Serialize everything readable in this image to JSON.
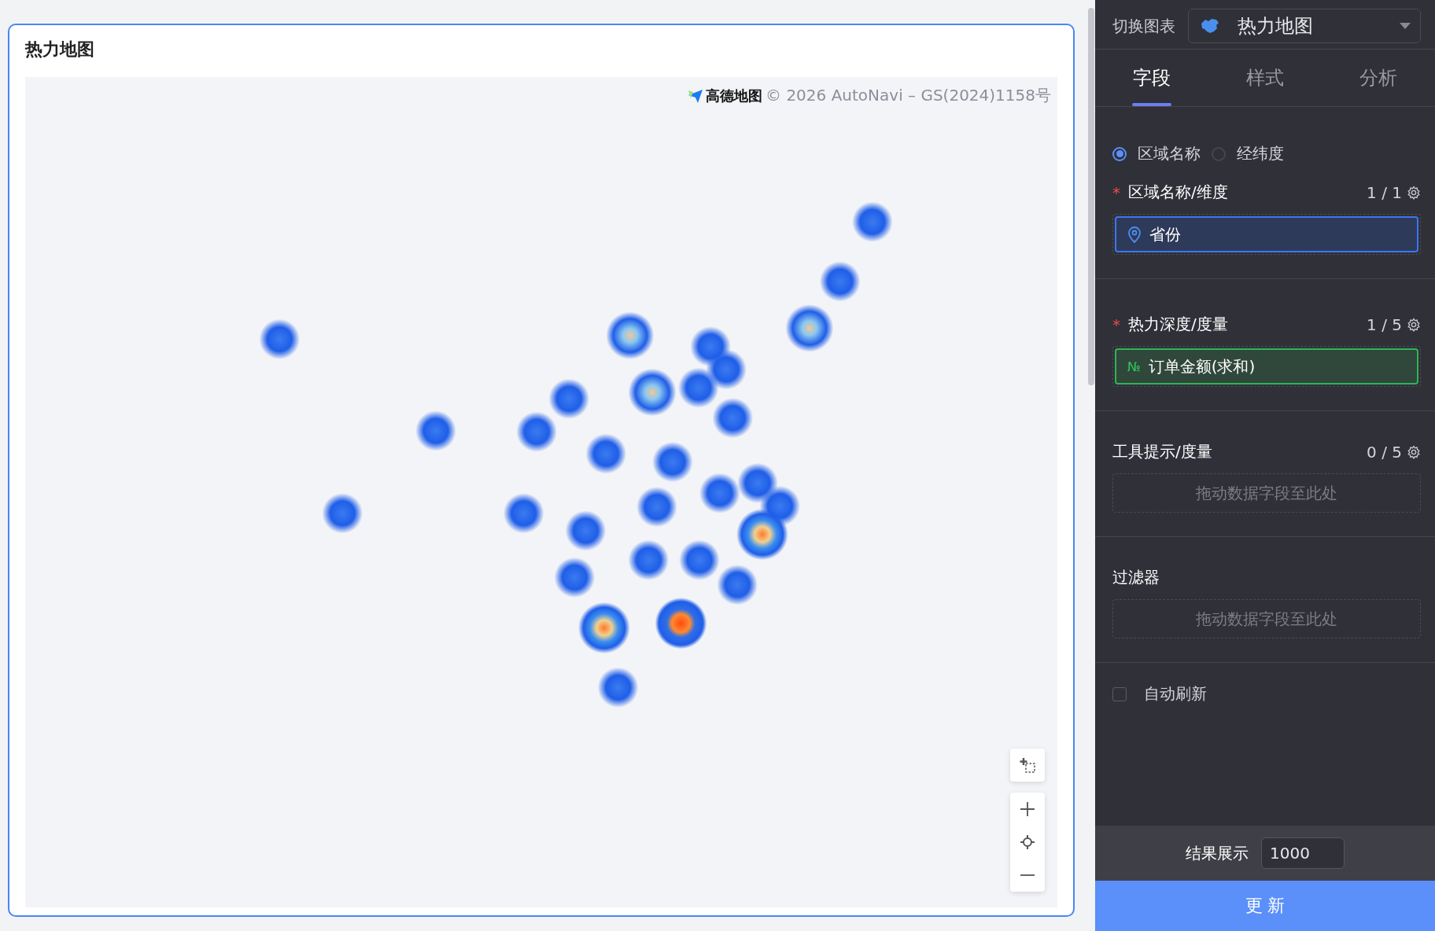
{
  "card": {
    "title": "热力地图",
    "attribution": "© 2026 AutoNavi – GS(2024)1158号",
    "map_logo": "高德地图"
  },
  "panel": {
    "switch_label": "切换图表",
    "chart_select": "热力地图",
    "tabs": [
      {
        "label": "字段",
        "selected": true
      },
      {
        "label": "样式",
        "selected": false
      },
      {
        "label": "分析",
        "selected": false
      }
    ],
    "location_modes": [
      {
        "label": "区域名称",
        "selected": true
      },
      {
        "label": "经纬度",
        "selected": false
      }
    ],
    "sections": [
      {
        "title": "区域名称/维度",
        "required_mark": "*",
        "count": "1 / 1",
        "items": [
          {
            "kind": "geo",
            "label": "省份"
          }
        ]
      },
      {
        "title": "热力深度/度量",
        "required_mark": "*",
        "count": "1 / 5",
        "items": [
          {
            "kind": "measure",
            "label": "订单金额(求和)",
            "prefix": "№"
          }
        ]
      },
      {
        "title": "工具提示/度量",
        "count": "0 / 5",
        "placeholder": "拖动数据字段至此处"
      },
      {
        "title": "过滤器",
        "placeholder": "拖动数据字段至此处"
      }
    ],
    "auto_refresh": {
      "label": "自动刷新",
      "checked": false
    },
    "result": {
      "label": "结果展示",
      "value": "1000"
    },
    "update_button": "更 新"
  }
}
